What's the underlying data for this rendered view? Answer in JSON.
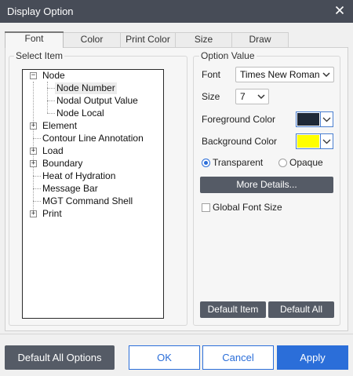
{
  "window": {
    "title": "Display Option"
  },
  "tabs": [
    {
      "label": "Font",
      "active": true
    },
    {
      "label": "Color"
    },
    {
      "label": "Print Color"
    },
    {
      "label": "Size"
    },
    {
      "label": "Draw"
    }
  ],
  "select_item": {
    "label": "Select Item",
    "tree": {
      "node": {
        "label": "Node",
        "expanded": true
      },
      "node_number": {
        "label": "Node Number",
        "selected": true
      },
      "nodal_output_value": {
        "label": "Nodal Output Value"
      },
      "node_local": {
        "label": "Node Local"
      },
      "element": {
        "label": "Element"
      },
      "contour_line_annotation": {
        "label": "Contour Line Annotation"
      },
      "load": {
        "label": "Load"
      },
      "boundary": {
        "label": "Boundary"
      },
      "heat_of_hydration": {
        "label": "Heat of Hydration"
      },
      "message_bar": {
        "label": "Message Bar"
      },
      "mgt_command_shell": {
        "label": "MGT Command Shell"
      },
      "print": {
        "label": "Print"
      }
    }
  },
  "option_value": {
    "label": "Option Value",
    "font_label": "Font",
    "font_value": "Times New Roman",
    "size_label": "Size",
    "size_value": "7",
    "foreground_label": "Foreground Color",
    "foreground_color": "#1f2937",
    "background_label": "Background Color",
    "background_color": "#ffff00",
    "transparent_label": "Transparent",
    "opaque_label": "Opaque",
    "transparent_selected": true,
    "more_details_label": "More Details...",
    "global_font_size_label": "Global Font Size",
    "global_font_size_checked": false,
    "default_item_label": "Default Item",
    "default_all_label": "Default All"
  },
  "footer": {
    "default_all_options_label": "Default All Options",
    "ok_label": "OK",
    "cancel_label": "Cancel",
    "apply_label": "Apply"
  },
  "colors": {
    "titlebar": "#474c57",
    "accent": "#2b6ed9",
    "dark_button": "#555b66"
  },
  "icons": [
    "close-icon",
    "expand-icon",
    "collapse-icon",
    "chevron-down-icon"
  ]
}
